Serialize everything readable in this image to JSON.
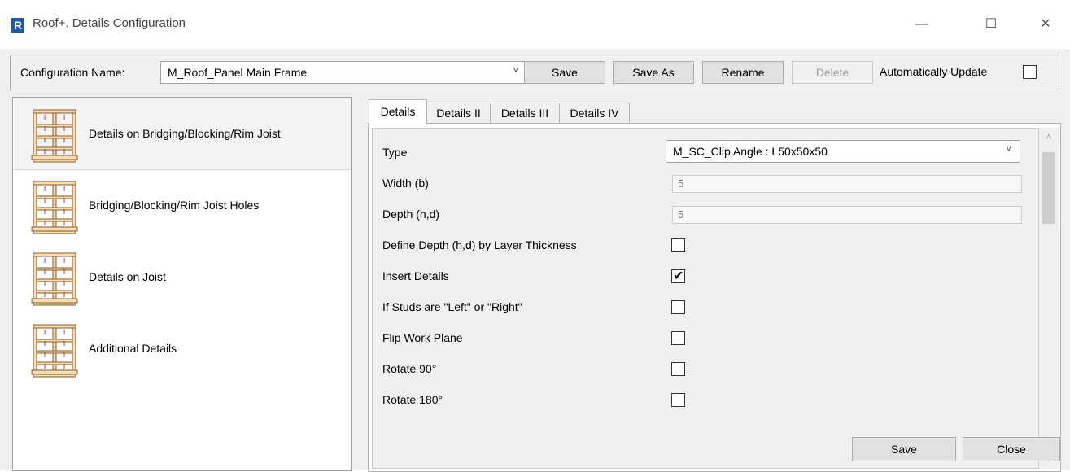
{
  "window": {
    "app_icon": "R",
    "title": "Roof+. Details Configuration",
    "minimize_glyph": "—",
    "maximize_glyph": "☐",
    "close_glyph": "✕"
  },
  "toolbar": {
    "config_label": "Configuration Name:",
    "config_value": "M_Roof_Panel Main Frame",
    "dropdown_glyph": "˅",
    "save": "Save",
    "save_as": "Save As",
    "rename": "Rename",
    "delete": "Delete",
    "auto_update_label": "Automatically Update",
    "auto_update_checked": false
  },
  "categories": [
    {
      "label": "Details on Bridging/Blocking/Rim Joist",
      "icon": "panel-frame-icon",
      "selected": true
    },
    {
      "label": "Bridging/Blocking/Rim Joist Holes",
      "icon": "panel-frame-icon",
      "selected": false
    },
    {
      "label": "Details on Joist",
      "icon": "panel-frame-icon",
      "selected": false
    },
    {
      "label": "Additional Details",
      "icon": "panel-frame-icon",
      "selected": false
    }
  ],
  "tabs": [
    {
      "label": "Details",
      "active": true
    },
    {
      "label": "Details II",
      "active": false
    },
    {
      "label": "Details III",
      "active": false
    },
    {
      "label": "Details IV",
      "active": false
    }
  ],
  "properties": [
    {
      "label": "Type",
      "kind": "dropdown",
      "value": "M_SC_Clip Angle : L50x50x50"
    },
    {
      "label": "Width (b)",
      "kind": "readonly",
      "value": "5"
    },
    {
      "label": "Depth (h,d)",
      "kind": "readonly",
      "value": "5"
    },
    {
      "label": "Define Depth (h,d) by Layer Thickness",
      "kind": "checkbox",
      "checked": false
    },
    {
      "label": "Insert Details",
      "kind": "checkbox",
      "checked": true
    },
    {
      "label": "If Studs are \"Left\" or \"Right\"",
      "kind": "checkbox",
      "checked": false
    },
    {
      "label": "Flip Work Plane",
      "kind": "checkbox",
      "checked": false
    },
    {
      "label": "Rotate 90°",
      "kind": "checkbox",
      "checked": false
    },
    {
      "label": "Rotate 180°",
      "kind": "checkbox",
      "checked": false
    }
  ],
  "scroll": {
    "up_glyph": "˄",
    "down_glyph": "˅"
  },
  "footer": {
    "save": "Save",
    "close": "Close"
  },
  "colors": {
    "frame_fill": "#f5deb3",
    "frame_stroke": "#8b5a2b",
    "frame_accent": "#c0392b",
    "app_icon_bg": "#1e5aa8",
    "focus_border": "#0078d7"
  }
}
